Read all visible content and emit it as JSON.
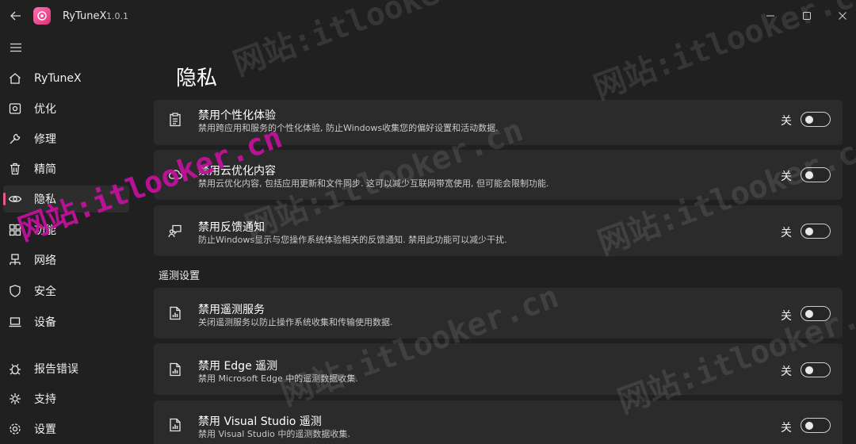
{
  "app": {
    "title": "RyTuneX",
    "version": "1.0.1"
  },
  "sidebar": {
    "items": [
      {
        "id": "home",
        "label": "RyTuneX",
        "icon": "home-icon",
        "active": false
      },
      {
        "id": "optimize",
        "label": "优化",
        "icon": "optimize-icon",
        "active": false
      },
      {
        "id": "repair",
        "label": "修理",
        "icon": "wrench-icon",
        "active": false
      },
      {
        "id": "debloat",
        "label": "精简",
        "icon": "trash-icon",
        "active": false
      },
      {
        "id": "privacy",
        "label": "隐私",
        "icon": "eye-icon",
        "active": true
      },
      {
        "id": "features",
        "label": "功能",
        "icon": "features-icon",
        "active": false
      },
      {
        "id": "network",
        "label": "网络",
        "icon": "network-icon",
        "active": false
      },
      {
        "id": "security",
        "label": "安全",
        "icon": "shield-icon",
        "active": false
      },
      {
        "id": "device",
        "label": "设备",
        "icon": "laptop-icon",
        "active": false
      }
    ],
    "footer_items": [
      {
        "id": "report-bug",
        "label": "报告错误",
        "icon": "bug-icon"
      },
      {
        "id": "support",
        "label": "支持",
        "icon": "support-icon"
      },
      {
        "id": "settings",
        "label": "设置",
        "icon": "gear-icon"
      }
    ]
  },
  "main": {
    "page_title": "隐私",
    "cards": [
      {
        "id": "personalized-experience",
        "icon": "clipboard-icon",
        "title": "禁用个性化体验",
        "description": "禁用跨应用和服务的个性化体验, 防止Windows收集您的偏好设置和活动数据.",
        "state_label": "关",
        "enabled": false
      },
      {
        "id": "cloud-optimized-content",
        "icon": "cloud-icon",
        "title": "禁用云优化内容",
        "description": "禁用云优化内容, 包括应用更新和文件同步. 这可以减少互联网带宽使用, 但可能会限制功能.",
        "state_label": "关",
        "enabled": false
      },
      {
        "id": "feedback-notifications",
        "icon": "feedback-icon",
        "title": "禁用反馈通知",
        "description": "防止Windows显示与您操作系统体验相关的反馈通知. 禁用此功能可以减少干扰.",
        "state_label": "关",
        "enabled": false
      }
    ],
    "telemetry_section": {
      "header": "遥测设置",
      "cards": [
        {
          "id": "telemetry-service",
          "icon": "report-icon",
          "title": "禁用遥测服务",
          "description": "关闭遥测服务以防止操作系统收集和传输使用数据.",
          "state_label": "关",
          "enabled": false
        },
        {
          "id": "edge-telemetry",
          "icon": "report-icon",
          "title": "禁用 Edge 遥测",
          "description": "禁用 Microsoft Edge 中的遥测数据收集.",
          "state_label": "关",
          "enabled": false
        },
        {
          "id": "vs-telemetry",
          "icon": "report-icon",
          "title": "禁用 Visual Studio 遥测",
          "description": "禁用 Visual Studio 中的遥测数据收集.",
          "state_label": "关",
          "enabled": false
        }
      ]
    }
  },
  "watermark": {
    "text": "网站:itlooker.cn"
  }
}
